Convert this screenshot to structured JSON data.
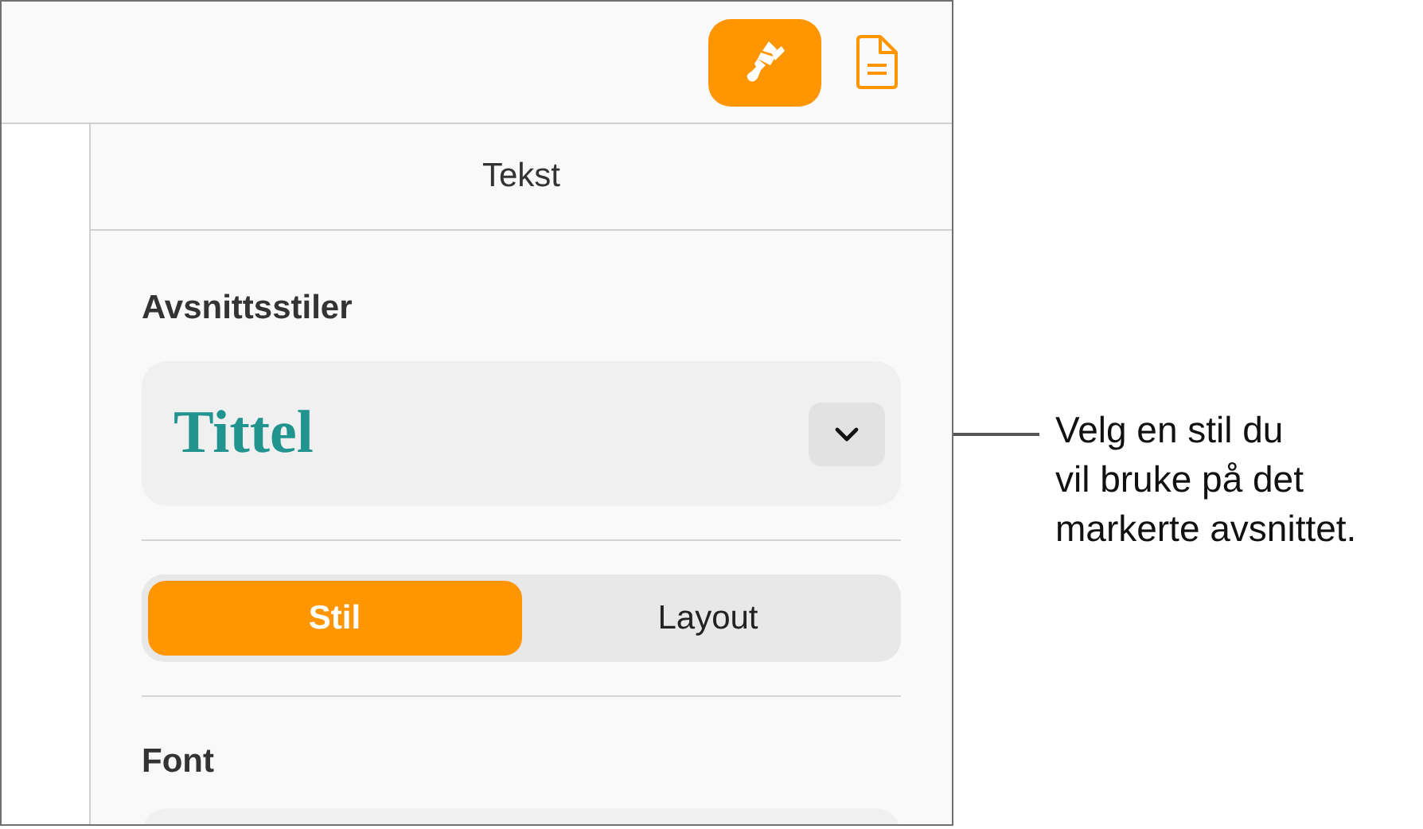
{
  "toolbar": {
    "buttons": [
      {
        "kind": "format",
        "selected": true
      },
      {
        "kind": "document",
        "selected": false
      }
    ]
  },
  "sidebar": {
    "title": "Tekst",
    "paragraph_styles": {
      "label": "Avsnittsstiler",
      "value": "Tittel"
    },
    "tabs": [
      {
        "label": "Stil",
        "selected": true
      },
      {
        "label": "Layout",
        "selected": false
      }
    ],
    "font": {
      "label": "Font"
    }
  },
  "callout": {
    "lines": [
      "Velg en stil du",
      "vil bruke på det",
      "markerte avsnittet."
    ]
  }
}
